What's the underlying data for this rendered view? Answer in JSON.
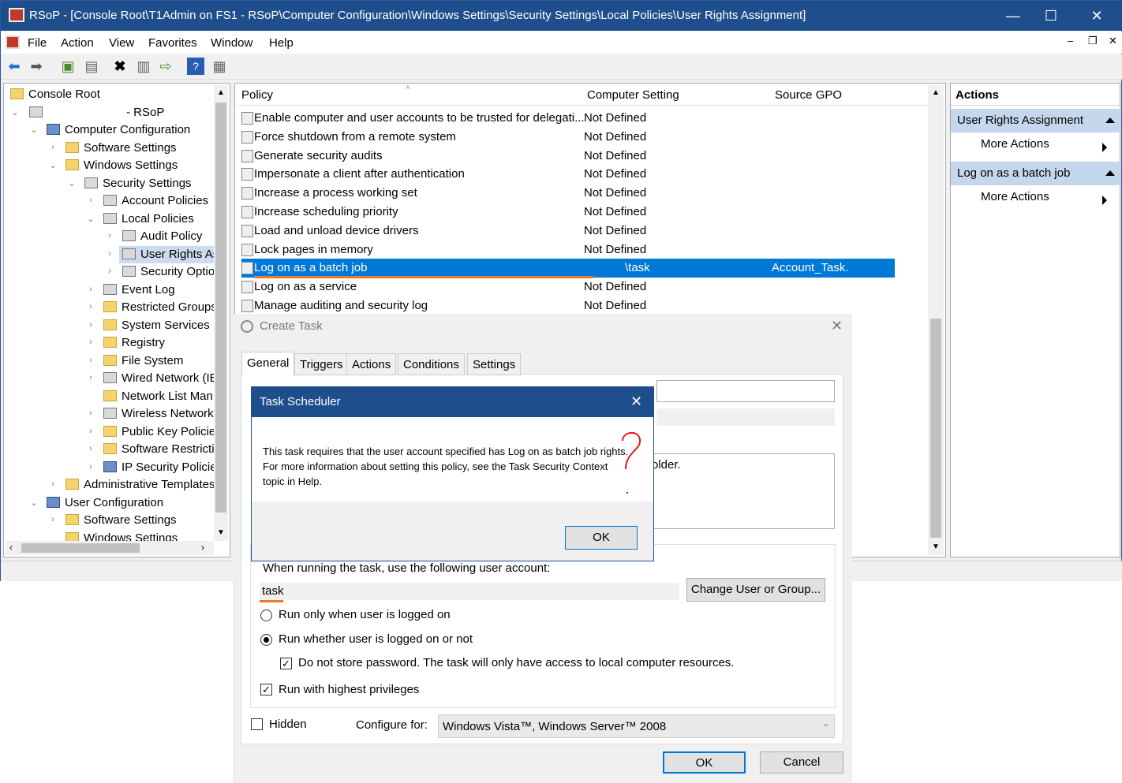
{
  "window": {
    "title": "RSoP - [Console Root\\T1Admin on FS1 - RSoP\\Computer Configuration\\Windows Settings\\Security Settings\\Local Policies\\User Rights Assignment]",
    "min": "—",
    "max": "☐",
    "close": "✕"
  },
  "menu": [
    "File",
    "Action",
    "View",
    "Favorites",
    "Window",
    "Help"
  ],
  "tree": {
    "items": [
      "Console Root",
      "- RSoP",
      "Computer Configuration",
      "Software Settings",
      "Windows Settings",
      "Security Settings",
      "Account Policies",
      "Local Policies",
      "Audit Policy",
      "User Rights As",
      "Security Optio",
      "Event Log",
      "Restricted Groups",
      "System Services",
      "Registry",
      "File System",
      "Wired Network (IE",
      "Network List Man",
      "Wireless Network",
      "Public Key Policies",
      "Software Restrictio",
      "IP Security Policies",
      "Administrative Templates",
      "User Configuration",
      "Software Settings",
      "Windows Settings"
    ]
  },
  "list": {
    "headers": [
      "Policy",
      "Computer Setting",
      "Source GPO"
    ],
    "rows": [
      {
        "p": "Enable computer and user accounts to be trusted for delegati...",
        "c": "Not Defined",
        "g": ""
      },
      {
        "p": "Force shutdown from a remote system",
        "c": "Not Defined",
        "g": ""
      },
      {
        "p": "Generate security audits",
        "c": "Not Defined",
        "g": ""
      },
      {
        "p": "Impersonate a client after authentication",
        "c": "Not Defined",
        "g": ""
      },
      {
        "p": "Increase a process working set",
        "c": "Not Defined",
        "g": ""
      },
      {
        "p": "Increase scheduling priority",
        "c": "Not Defined",
        "g": ""
      },
      {
        "p": "Load and unload device drivers",
        "c": "Not Defined",
        "g": ""
      },
      {
        "p": "Lock pages in memory",
        "c": "Not Defined",
        "g": ""
      },
      {
        "p": "Log on as a batch job",
        "c": "\\task",
        "g": "Account_Task."
      },
      {
        "p": "Log on as a service",
        "c": "Not Defined",
        "g": ""
      },
      {
        "p": "Manage auditing and security log",
        "c": "Not Defined",
        "g": ""
      }
    ]
  },
  "actions": {
    "header": "Actions",
    "sec1": "User Rights Assignment",
    "more1": "More Actions",
    "sec2": "Log on as a batch job",
    "more2": "More Actions"
  },
  "task": {
    "title": "Create Task",
    "tabs": [
      "General",
      "Triggers",
      "Actions",
      "Conditions",
      "Settings"
    ],
    "partial_text": "older.",
    "account_label": "When running the task, use the following user account:",
    "account": "task",
    "change_btn": "Change User or Group...",
    "r1": "Run only when user is logged on",
    "r2": "Run whether user is logged on or not",
    "nostore": "Do not store password.  The task will only have access to local computer resources.",
    "highest": "Run with highest privileges",
    "hidden": "Hidden",
    "configure_label": "Configure for:",
    "configure_value": "Windows Vista™, Windows Server™ 2008",
    "ok": "OK",
    "cancel": "Cancel"
  },
  "msgbox": {
    "title": "Task Scheduler",
    "line1": "This task requires that the user account specified has Log on as batch job rights.",
    "line2": "For more information about setting this policy, see the Task Security Context",
    "line3": "topic in Help.",
    "ok": "OK"
  },
  "colors": {
    "titlebar": "#1f4e8c",
    "selection": "#0078d7",
    "annotation": "#e31919",
    "underline": "#f07820"
  }
}
